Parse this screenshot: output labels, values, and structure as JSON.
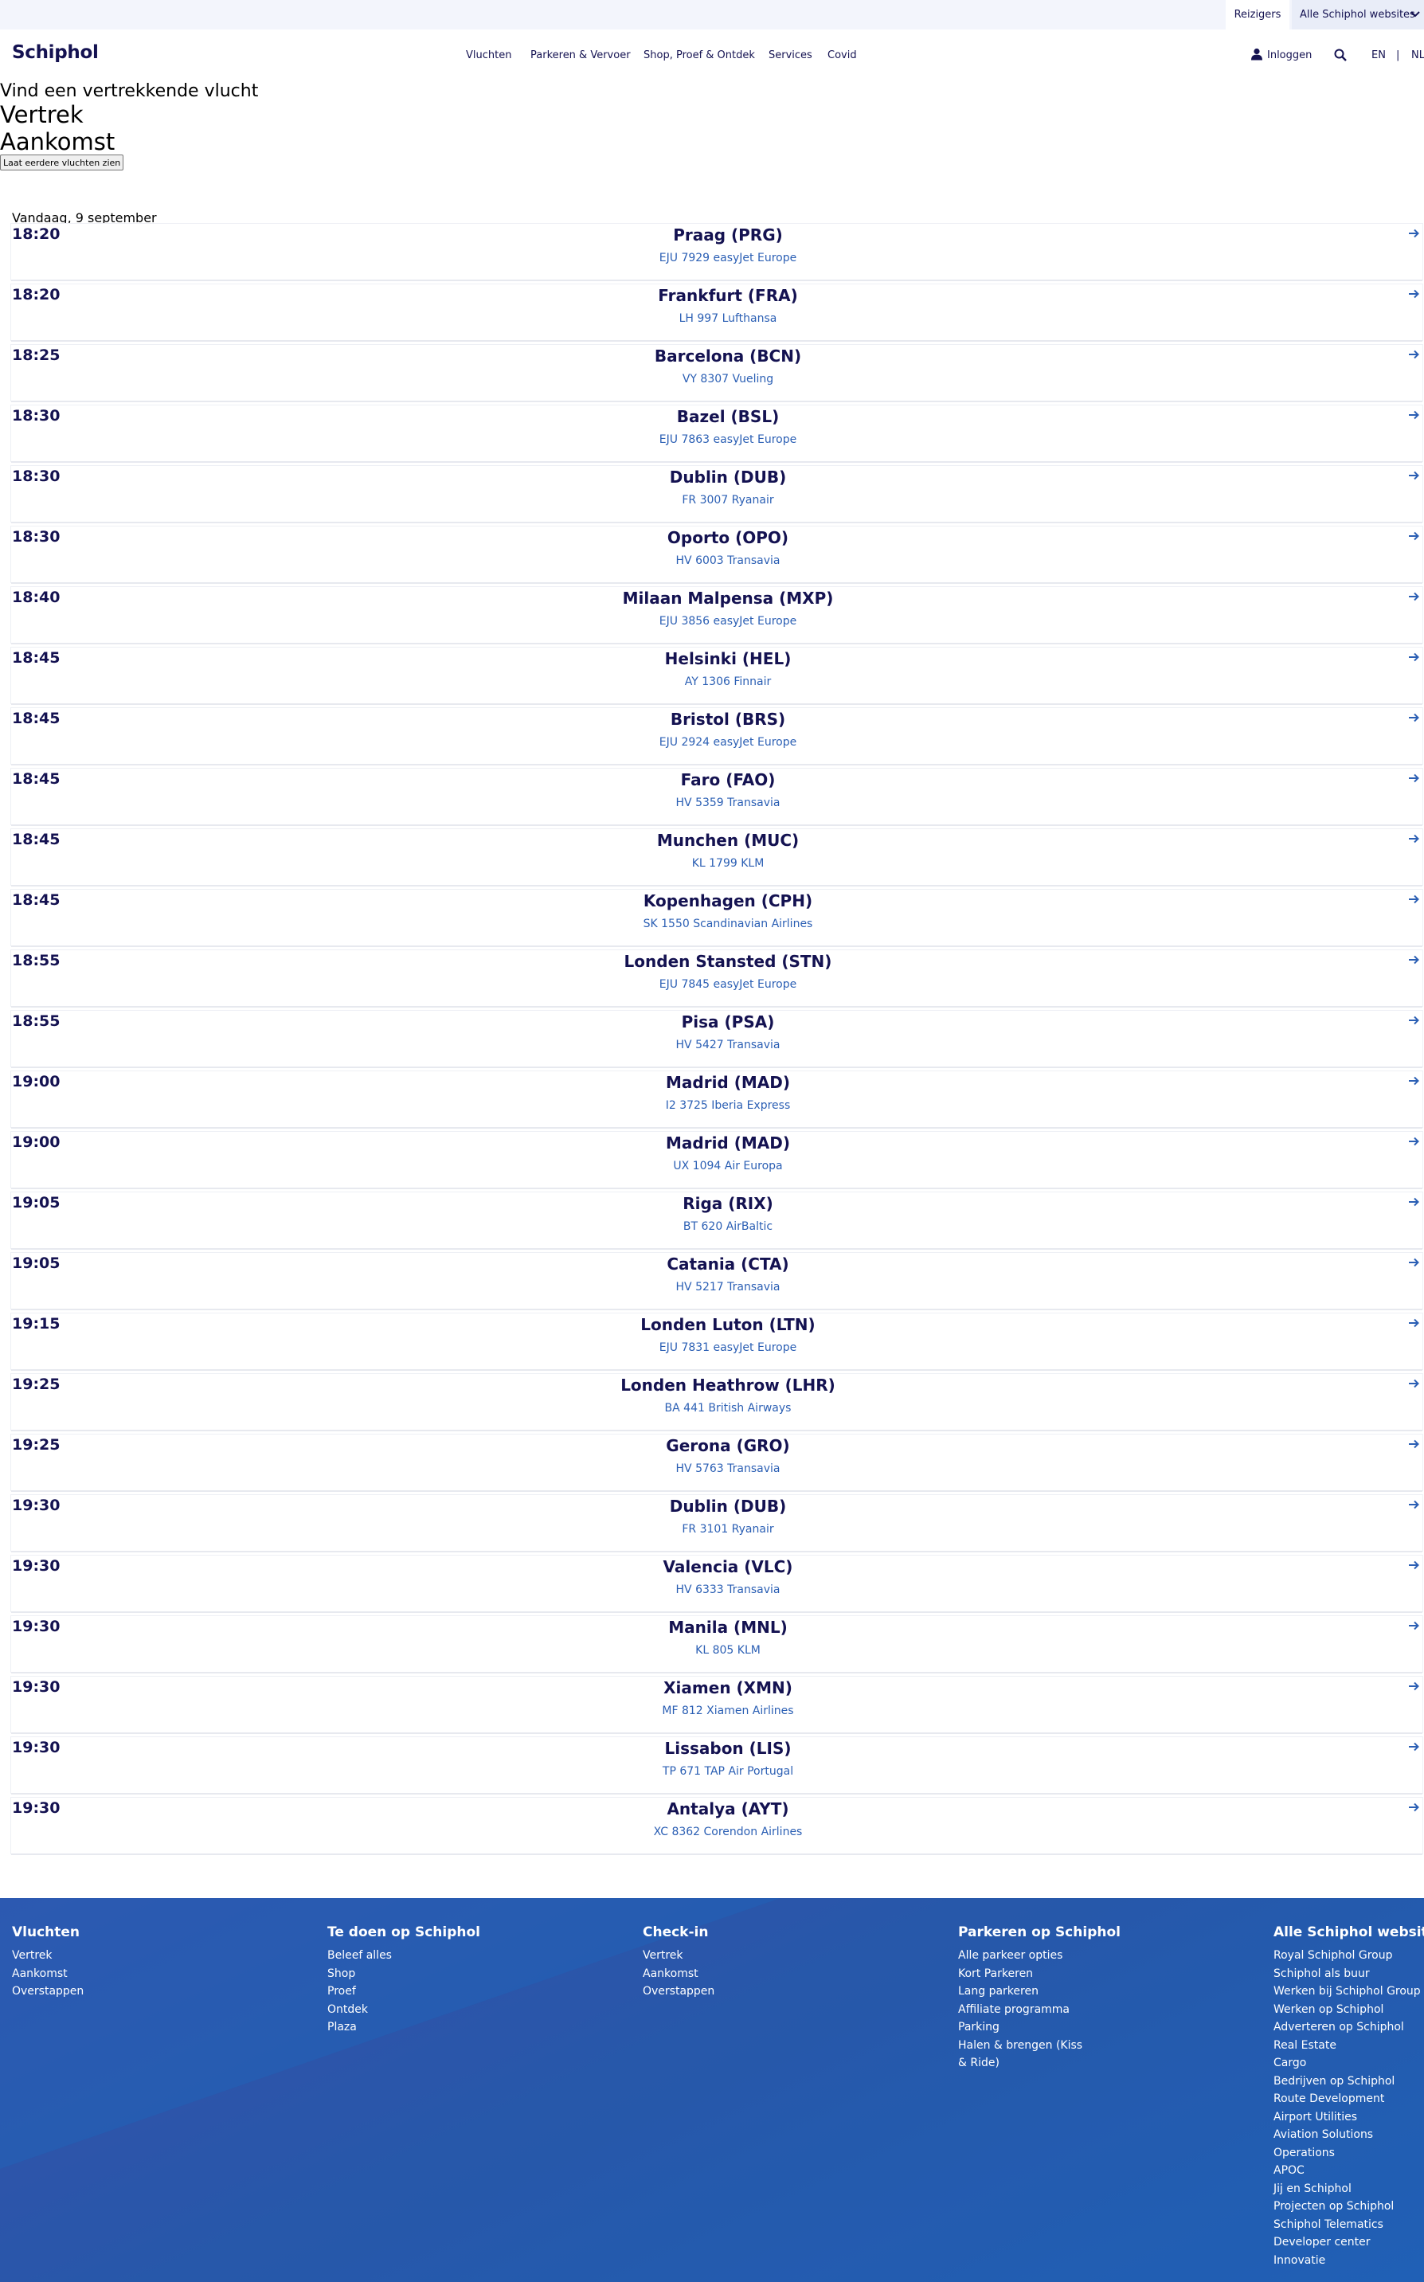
{
  "topbar": {
    "travelers": "Reizigers",
    "all_websites": "Alle Schiphol websites"
  },
  "header": {
    "logo": "Schiphol",
    "nav": [
      "Vluchten",
      "Parkeren & Vervoer",
      "Shop, Proef & Ontdek",
      "Services",
      "Covid"
    ],
    "login": "Inloggen",
    "lang_en": "EN",
    "lang_sep": "|",
    "lang_nl": "NL"
  },
  "search": {
    "heading": "Vind een vertrekkende vlucht",
    "tab_departures": "Vertrek",
    "tab_arrivals": "Aankomst",
    "earlier_button": "Laat eerdere vluchten zien"
  },
  "date_label": "Vandaag, 9 september",
  "flights": [
    {
      "time": "18:20",
      "destination": "Praag (PRG)",
      "info": "EJU 7929 easyJet Europe"
    },
    {
      "time": "18:20",
      "destination": "Frankfurt (FRA)",
      "info": "LH 997 Lufthansa"
    },
    {
      "time": "18:25",
      "destination": "Barcelona (BCN)",
      "info": "VY 8307 Vueling"
    },
    {
      "time": "18:30",
      "destination": "Bazel (BSL)",
      "info": "EJU 7863 easyJet Europe"
    },
    {
      "time": "18:30",
      "destination": "Dublin (DUB)",
      "info": "FR 3007 Ryanair"
    },
    {
      "time": "18:30",
      "destination": "Oporto (OPO)",
      "info": "HV 6003 Transavia"
    },
    {
      "time": "18:40",
      "destination": "Milaan Malpensa (MXP)",
      "info": "EJU 3856 easyJet Europe"
    },
    {
      "time": "18:45",
      "destination": "Helsinki (HEL)",
      "info": "AY 1306 Finnair"
    },
    {
      "time": "18:45",
      "destination": "Bristol (BRS)",
      "info": "EJU 2924 easyJet Europe"
    },
    {
      "time": "18:45",
      "destination": "Faro (FAO)",
      "info": "HV 5359 Transavia"
    },
    {
      "time": "18:45",
      "destination": "Munchen (MUC)",
      "info": "KL 1799 KLM"
    },
    {
      "time": "18:45",
      "destination": "Kopenhagen (CPH)",
      "info": "SK 1550 Scandinavian Airlines"
    },
    {
      "time": "18:55",
      "destination": "Londen Stansted (STN)",
      "info": "EJU 7845 easyJet Europe"
    },
    {
      "time": "18:55",
      "destination": "Pisa (PSA)",
      "info": "HV 5427 Transavia"
    },
    {
      "time": "19:00",
      "destination": "Madrid (MAD)",
      "info": "I2 3725 Iberia Express"
    },
    {
      "time": "19:00",
      "destination": "Madrid (MAD)",
      "info": "UX 1094 Air Europa"
    },
    {
      "time": "19:05",
      "destination": "Riga (RIX)",
      "info": "BT 620 AirBaltic"
    },
    {
      "time": "19:05",
      "destination": "Catania (CTA)",
      "info": "HV 5217 Transavia"
    },
    {
      "time": "19:15",
      "destination": "Londen Luton (LTN)",
      "info": "EJU 7831 easyJet Europe"
    },
    {
      "time": "19:25",
      "destination": "Londen Heathrow (LHR)",
      "info": "BA 441 British Airways"
    },
    {
      "time": "19:25",
      "destination": "Gerona (GRO)",
      "info": "HV 5763 Transavia"
    },
    {
      "time": "19:30",
      "destination": "Dublin (DUB)",
      "info": "FR 3101 Ryanair"
    },
    {
      "time": "19:30",
      "destination": "Valencia (VLC)",
      "info": "HV 6333 Transavia"
    },
    {
      "time": "19:30",
      "destination": "Manila (MNL)",
      "info": "KL 805 KLM"
    },
    {
      "time": "19:30",
      "destination": "Xiamen (XMN)",
      "info": "MF 812 Xiamen Airlines"
    },
    {
      "time": "19:30",
      "destination": "Lissabon (LIS)",
      "info": "TP 671 TAP Air Portugal"
    },
    {
      "time": "19:30",
      "destination": "Antalya (AYT)",
      "info": "XC 8362 Corendon Airlines"
    }
  ],
  "footer": {
    "columns": [
      {
        "title": "Vluchten",
        "links": [
          "Vertrek",
          "Aankomst",
          "Overstappen"
        ]
      },
      {
        "title": "Te doen op Schiphol",
        "links": [
          "Beleef alles",
          "Shop",
          "Proef",
          "Ontdek",
          "Plaza"
        ]
      },
      {
        "title": "Check-in",
        "links": [
          "Vertrek",
          "Aankomst",
          "Overstappen"
        ]
      },
      {
        "title": "Parkeren op Schiphol",
        "links": [
          "Alle parkeer opties",
          "Kort Parkeren",
          "Lang parkeren",
          "Affiliate programma",
          "Parking",
          "Halen & brengen (Kiss & Ride)"
        ]
      },
      {
        "title": "Alle Schiphol websites",
        "links": [
          "Royal Schiphol Group",
          "Schiphol als buur",
          "Werken bij Schiphol Group",
          "Werken op Schiphol",
          "Adverteren op Schiphol",
          "Real Estate",
          "Cargo",
          "Bedrijven op Schiphol",
          "Route Development",
          "Airport Utilities",
          "Aviation Solutions",
          "Operations",
          "APOC",
          "Jij en Schiphol",
          "Projecten op Schiphol",
          "Schiphol Telematics",
          "Developer center",
          "Innovatie"
        ]
      }
    ]
  },
  "colors": {
    "brand_navy": "#141251",
    "link_blue": "#2b5fb4",
    "footer_blue": "#1f63b8",
    "topbar_bg": "#f3f5fc"
  }
}
